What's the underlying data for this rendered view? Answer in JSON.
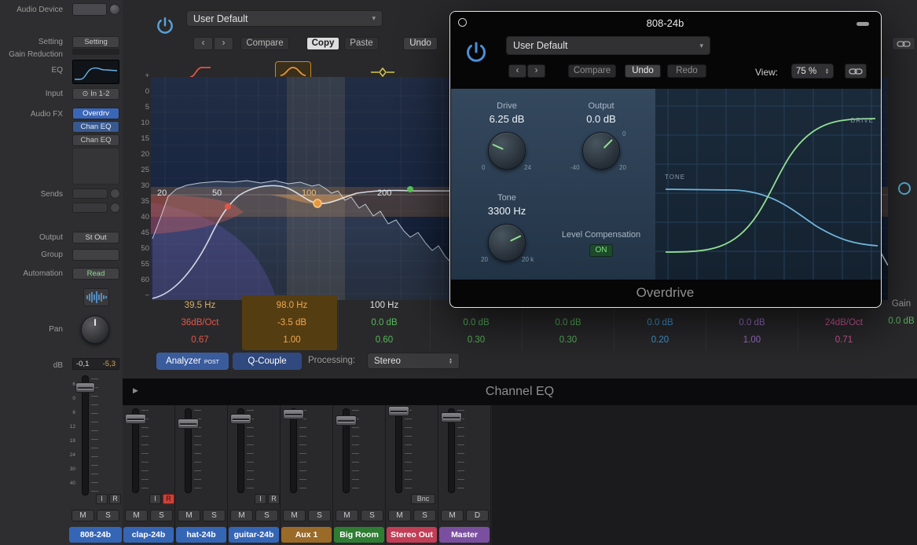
{
  "inspector": {
    "labels": {
      "audio_device": "Audio Device",
      "setting": "Setting",
      "gain_reduction": "Gain Reduction",
      "eq": "EQ",
      "input": "Input",
      "audio_fx": "Audio FX",
      "sends": "Sends",
      "output": "Output",
      "group": "Group",
      "automation": "Automation",
      "pan": "Pan",
      "db": "dB"
    },
    "setting_button": "Setting",
    "input_value": "In 1-2",
    "audio_fx_slots": [
      "Overdrv",
      "Chan EQ",
      "Chan EQ"
    ],
    "output_value": "St Out",
    "automation_value": "Read",
    "db_left": "-0,1",
    "db_right": "-5,3",
    "fader_scale": [
      "6",
      "0",
      "6",
      "12",
      "18",
      "24",
      "30",
      "40"
    ]
  },
  "channel_eq": {
    "preset": "User Default",
    "nav_back": "‹",
    "nav_fwd": "›",
    "compare": "Compare",
    "copy": "Copy",
    "paste": "Paste",
    "undo": "Undo",
    "db_scale": [
      "+",
      "0",
      "5",
      "10",
      "15",
      "20",
      "25",
      "30",
      "35",
      "40",
      "45",
      "50",
      "55",
      "60",
      "−"
    ],
    "freq_labels": [
      "20",
      "50",
      "100",
      "200"
    ],
    "bands": [
      {
        "freq": "39.5 Hz",
        "gain": "36dB/Oct",
        "q": "0.67",
        "color": "#e8554a"
      },
      {
        "freq": "98.0 Hz",
        "gain": "-3.5 dB",
        "q": "1.00",
        "color": "#e8963c"
      },
      {
        "freq": "100 Hz",
        "gain": "0.0 dB",
        "q": "0.60",
        "color": "#56b85a"
      },
      {
        "freq": "",
        "gain": "0.0 dB",
        "q": "0.30",
        "color": "#56b85a"
      },
      {
        "freq": "",
        "gain": "0.0 dB",
        "q": "0.30",
        "color": "#56b85a"
      },
      {
        "freq": "",
        "gain": "0.0 dB",
        "q": "0.20",
        "color": "#42a0dc"
      },
      {
        "freq": "",
        "gain": "0.0 dB",
        "q": "1.00",
        "color": "#a36fd6"
      },
      {
        "freq": "",
        "gain": "24dB/Oct",
        "q": "0.71",
        "color": "#d9579d"
      }
    ],
    "gain_label": "Gain",
    "gain_value": "0.0 dB",
    "analyzer": "Analyzer",
    "analyzer_mode": "POST",
    "q_couple": "Q-Couple",
    "processing_label": "Processing:",
    "processing_value": "Stereo",
    "window_title": "Channel EQ"
  },
  "overdrive": {
    "window_title": "808-24b",
    "preset": "User Default",
    "nav_back": "‹",
    "nav_fwd": "›",
    "compare": "Compare",
    "undo": "Undo",
    "redo": "Redo",
    "view_label": "View:",
    "view_value": "75 %",
    "drive_label": "Drive",
    "drive_value": "6.25 dB",
    "drive_min": "0",
    "drive_max": "24",
    "output_label": "Output",
    "output_value": "0.0 dB",
    "output_min": "-40",
    "output_max": "20",
    "output_marker": "0",
    "tone_label": "Tone",
    "tone_value": "3300 Hz",
    "tone_min": "20",
    "tone_max": "20 k",
    "level_comp_label": "Level Compensation",
    "level_comp_value": "ON",
    "graph_drive_label": "DRIVE",
    "graph_tone_label": "TONE",
    "title": "Overdrive",
    "accent_green": "#92e092",
    "accent_blue": "#4a90d9"
  },
  "mixer": {
    "input_monitor": "I",
    "record": "R",
    "mute": "M",
    "solo": "S",
    "bounce": "Bnc",
    "master_d": "D",
    "channels": [
      {
        "name": "808-24b",
        "color": "#3565b5"
      },
      {
        "name": "clap-24b",
        "color": "#3565b5"
      },
      {
        "name": "hat-24b",
        "color": "#3565b5"
      },
      {
        "name": "guitar-24b",
        "color": "#3565b5"
      },
      {
        "name": "Aux 1",
        "color": "#9a6a28"
      },
      {
        "name": "Big Room",
        "color": "#2f7d33"
      },
      {
        "name": "Stereo Out",
        "color": "#c23d56"
      },
      {
        "name": "Master",
        "color": "#7b4fa0"
      }
    ]
  },
  "icons": {
    "chevron_down": "▾",
    "stereo_input": "⊙",
    "disclosure": "▶",
    "spin_up": "▲",
    "spin_down": "▼"
  }
}
